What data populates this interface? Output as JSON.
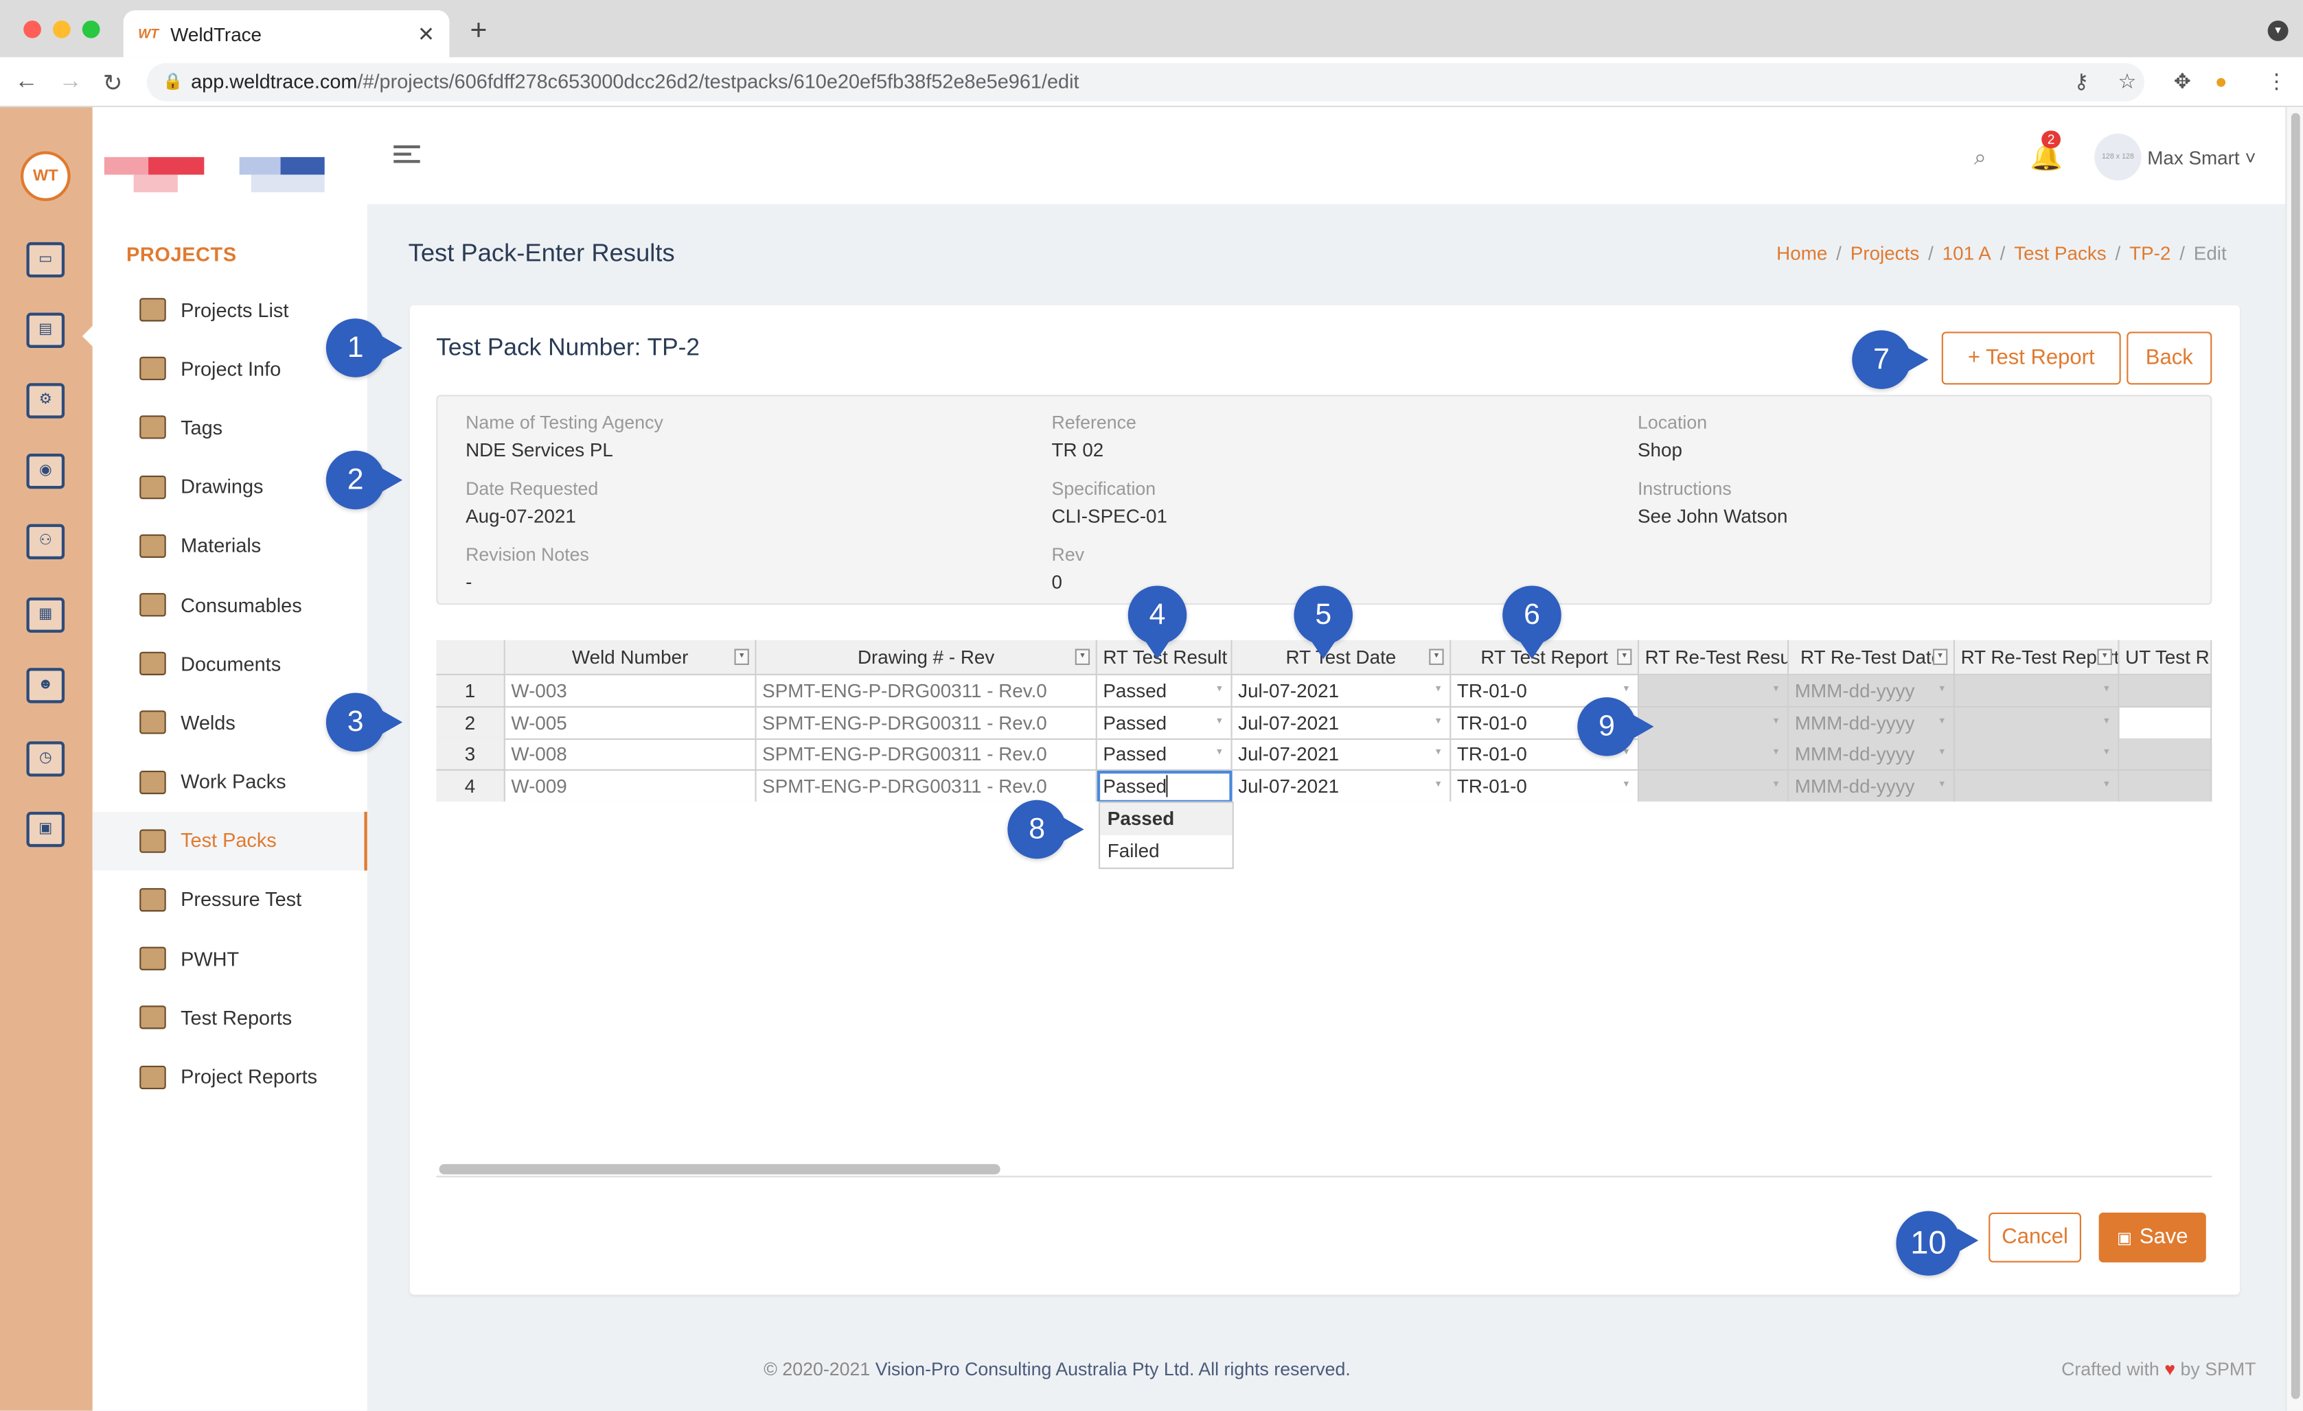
{
  "browser": {
    "tab_title": "WeldTrace",
    "tab_favicon": "WT",
    "url_host": "app.weldtrace.com",
    "url_path": "/#/projects/606fdff278c653000dcc26d2/testpacks/610e20ef5fb38f52e8e5e961/edit"
  },
  "topbar": {
    "notification_count": "2",
    "avatar_text": "128 x 128",
    "user_name": "Max Smart ˅"
  },
  "sidebar": {
    "section": "PROJECTS",
    "items": [
      {
        "label": "Projects List",
        "icon": "camera-icon"
      },
      {
        "label": "Project Info",
        "icon": "truck-icon"
      },
      {
        "label": "Tags",
        "icon": "tag-icon"
      },
      {
        "label": "Drawings",
        "icon": "drawing-icon"
      },
      {
        "label": "Materials",
        "icon": "materials-icon"
      },
      {
        "label": "Consumables",
        "icon": "spool-icon"
      },
      {
        "label": "Documents",
        "icon": "folder-icon"
      },
      {
        "label": "Welds",
        "icon": "weld-icon"
      },
      {
        "label": "Work Packs",
        "icon": "work-pack-icon"
      },
      {
        "label": "Test Packs",
        "icon": "radiation-icon",
        "active": true
      },
      {
        "label": "Pressure Test",
        "icon": "gauge-icon"
      },
      {
        "label": "PWHT",
        "icon": "heater-icon"
      },
      {
        "label": "Test Reports",
        "icon": "clipboard-icon"
      },
      {
        "label": "Project Reports",
        "icon": "report-icon"
      }
    ]
  },
  "page": {
    "title": "Test Pack-Enter Results",
    "breadcrumb": [
      "Home",
      "Projects",
      "101 A",
      "Test Packs",
      "TP-2",
      "Edit"
    ]
  },
  "card": {
    "test_pack_number": "Test Pack Number: TP-2",
    "add_report_button": "+ Test Report",
    "back_button": "Back",
    "cancel_button": "Cancel",
    "save_button": "Save"
  },
  "info": {
    "agency_label": "Name of Testing Agency",
    "agency_value": "NDE Services PL",
    "reference_label": "Reference",
    "reference_value": "TR 02",
    "location_label": "Location",
    "location_value": "Shop",
    "date_label": "Date Requested",
    "date_value": "Aug-07-2021",
    "spec_label": "Specification",
    "spec_value": "CLI-SPEC-01",
    "instructions_label": "Instructions",
    "instructions_value": "See John Watson",
    "revnotes_label": "Revision Notes",
    "revnotes_value": "-",
    "rev_label": "Rev",
    "rev_value": "0"
  },
  "grid": {
    "headers": [
      "Weld Number",
      "Drawing # - Rev",
      "RT Test Result",
      "RT Test Date",
      "RT Test Report",
      "RT Re-Test Resu",
      "RT Re-Test Date",
      "RT Re-Test Report",
      "UT Test R"
    ],
    "rows": [
      {
        "n": "1",
        "weld": "W-003",
        "drawing": "SPMT-ENG-P-DRG00311 - Rev.0",
        "result": "Passed",
        "date": "Jul-07-2021",
        "report": "TR-01-0",
        "re_date": "MMM-dd-yyyy"
      },
      {
        "n": "2",
        "weld": "W-005",
        "drawing": "SPMT-ENG-P-DRG00311 - Rev.0",
        "result": "Passed",
        "date": "Jul-07-2021",
        "report": "TR-01-0",
        "re_date": "MMM-dd-yyyy"
      },
      {
        "n": "3",
        "weld": "W-008",
        "drawing": "SPMT-ENG-P-DRG00311 - Rev.0",
        "result": "Passed",
        "date": "Jul-07-2021",
        "report": "TR-01-0",
        "re_date": "MMM-dd-yyyy"
      },
      {
        "n": "4",
        "weld": "W-009",
        "drawing": "SPMT-ENG-P-DRG00311 - Rev.0",
        "result": "Passed",
        "date": "Jul-07-2021",
        "report": "TR-01-0",
        "re_date": "MMM-dd-yyyy"
      }
    ],
    "dropdown_options": [
      "Passed",
      "Failed"
    ]
  },
  "callouts": [
    "1",
    "2",
    "3",
    "4",
    "5",
    "6",
    "7",
    "8",
    "9",
    "10"
  ],
  "footer": {
    "copyright": "© 2020-2021",
    "company": "Vision-Pro Consulting Australia Pty Ltd. All rights reserved.",
    "crafted_prefix": "Crafted with",
    "crafted_suffix": "by SPMT"
  },
  "colors": {
    "accent": "#e07a2f",
    "rail": "#e5b48f",
    "callout": "#2f5fbf"
  }
}
